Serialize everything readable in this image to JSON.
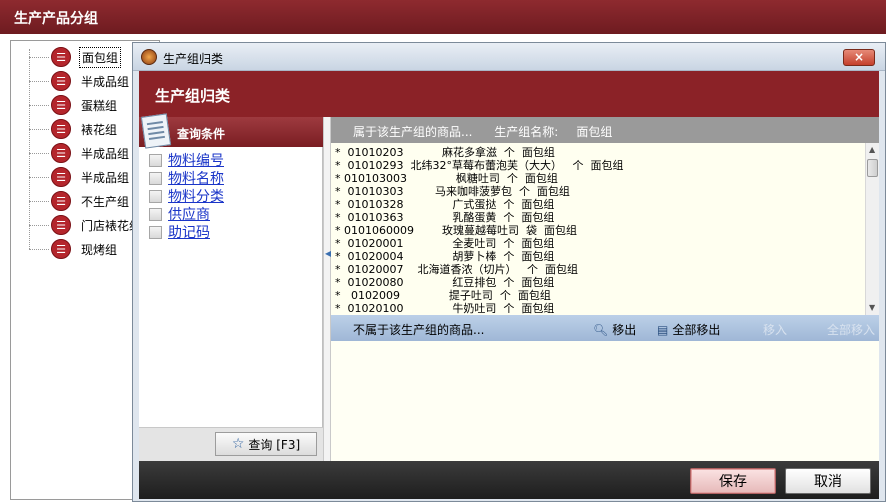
{
  "outer_window": {
    "title": "生产产品分组"
  },
  "tree": {
    "items": [
      {
        "label": "面包组",
        "selected": true
      },
      {
        "label": "半成品组"
      },
      {
        "label": "蛋糕组"
      },
      {
        "label": "裱花组"
      },
      {
        "label": "半成品组"
      },
      {
        "label": "半成品组"
      },
      {
        "label": "不生产组"
      },
      {
        "label": "门店裱花组"
      },
      {
        "label": "现烤组"
      }
    ]
  },
  "dialog": {
    "title": "生产组归类",
    "close_label": "×",
    "header": "生产组归类",
    "query": {
      "title": "查询条件",
      "options": [
        "物料编号",
        "物料名称",
        "物料分类",
        "供应商",
        "助记码"
      ],
      "button_label": "查询 [F3]"
    },
    "belong": {
      "title": "属于该生产组的商品...",
      "group_name_label": "生产组名称:",
      "group_name": "面包组",
      "rows": [
        "*  01010203           麻花多拿滋  个  面包组",
        "*  01010293  北纬32°草莓布蕾泡芙（大大）   个  面包组",
        "* 010103003              枫糖吐司  个  面包组",
        "*  01010303         马来咖啡菠萝包  个  面包组",
        "*  01010328              广式蛋挞  个  面包组",
        "*  01010363              乳酪蛋黄  个  面包组",
        "* 0101060009        玫瑰蔓越莓吐司  袋  面包组",
        "*  01020001              全麦吐司  个  面包组",
        "*  01020004              胡萝卜棒  个  面包组",
        "*  01020007    北海道香浓（切片）   个  面包组",
        "*  01020080              红豆排包  个  面包组",
        "*   0102009              提子吐司  个  面包组",
        "*  01020100              牛奶吐司  个  面包组"
      ]
    },
    "not_belong": {
      "title": "不属于该生产组的商品...",
      "remove_label": "移出",
      "remove_all_label": "全部移出",
      "add_label": "移入",
      "add_all_label": "全部移入"
    },
    "footer": {
      "save_label": "保存",
      "cancel_label": "取消"
    }
  }
}
